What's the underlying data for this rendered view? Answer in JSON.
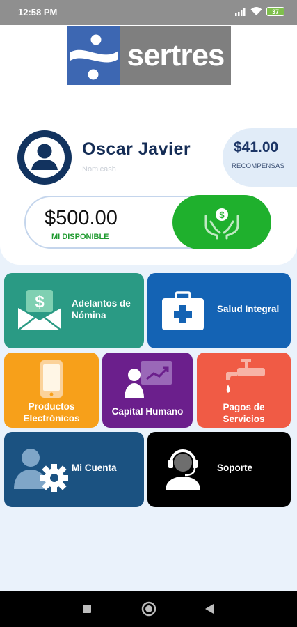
{
  "status_bar": {
    "time": "12:58 PM",
    "battery": "37"
  },
  "logo": {
    "word": "sertres"
  },
  "user": {
    "name": "Oscar Javier",
    "subtitle": "Nomicash"
  },
  "rewards": {
    "amount": "$41.00",
    "label": "RECOMPENSAS"
  },
  "balance": {
    "amount": "$500.00",
    "label": "MI DISPONIBLE"
  },
  "tiles": {
    "adelantos": {
      "line1": "Adelantos de",
      "line2": "Nómina",
      "color": "#2a9a84"
    },
    "salud": {
      "label": "Salud Integral",
      "color": "#1463b4"
    },
    "productos": {
      "line1": "Productos",
      "line2": "Electrónicos",
      "color": "#f7a01a"
    },
    "capital": {
      "label": "Capital Humano",
      "color": "#6b1f8c"
    },
    "pagos": {
      "line1": "Pagos de",
      "line2": "Servicios",
      "color": "#f05b45"
    },
    "cuenta": {
      "label": "Mi Cuenta",
      "color": "#1b5281"
    },
    "soporte": {
      "label": "Soporte",
      "color": "#000000"
    }
  },
  "icons": {
    "logo": "sertres-mark-icon",
    "avatar": "user-avatar-icon",
    "withdraw": "hands-money-icon",
    "adelantos": "money-envelope-icon",
    "salud": "first-aid-kit-icon",
    "productos": "smartphone-icon",
    "capital": "presenter-chart-icon",
    "pagos": "faucet-icon",
    "cuenta": "user-settings-icon",
    "soporte": "headset-agent-icon"
  }
}
